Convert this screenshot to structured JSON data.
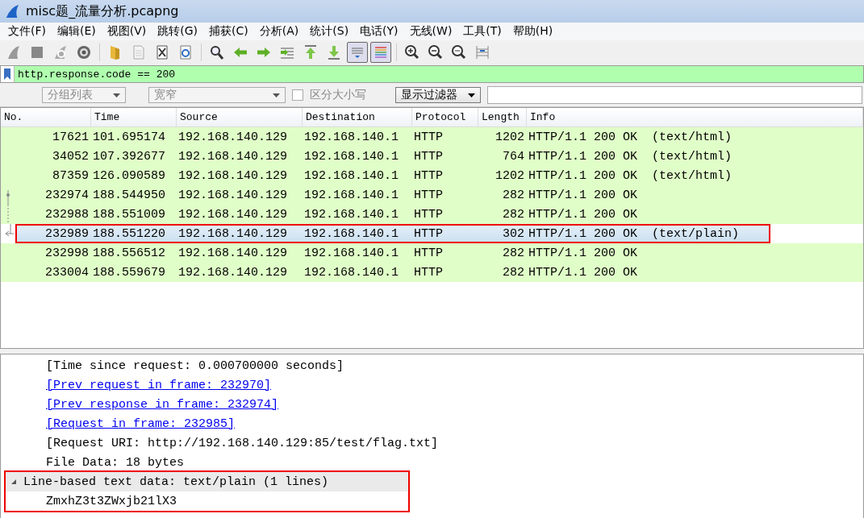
{
  "window": {
    "title": "misc题_流量分析.pcapng"
  },
  "menu": [
    "文件(F)",
    "编辑(E)",
    "视图(V)",
    "跳转(G)",
    "捕获(C)",
    "分析(A)",
    "统计(S)",
    "电话(Y)",
    "无线(W)",
    "工具(T)",
    "帮助(H)"
  ],
  "toolbar": [
    {
      "kind": "fin",
      "pressed": false
    },
    {
      "kind": "stop",
      "pressed": false
    },
    {
      "kind": "restart",
      "pressed": false
    },
    {
      "kind": "gear",
      "pressed": false
    },
    {
      "kind": "sep"
    },
    {
      "kind": "folder",
      "pressed": false
    },
    {
      "kind": "file",
      "pressed": false
    },
    {
      "kind": "closefile",
      "pressed": false
    },
    {
      "kind": "reload",
      "pressed": false
    },
    {
      "kind": "sep"
    },
    {
      "kind": "search",
      "pressed": false
    },
    {
      "kind": "back",
      "pressed": false
    },
    {
      "kind": "forward",
      "pressed": false
    },
    {
      "kind": "goto",
      "pressed": false
    },
    {
      "kind": "first",
      "pressed": false
    },
    {
      "kind": "last",
      "pressed": false
    },
    {
      "kind": "autoscroll",
      "pressed": true
    },
    {
      "kind": "colorize",
      "pressed": true
    },
    {
      "kind": "sep"
    },
    {
      "kind": "zoomin",
      "pressed": false
    },
    {
      "kind": "zoomout",
      "pressed": false
    },
    {
      "kind": "zoomreset",
      "pressed": false
    },
    {
      "kind": "resize",
      "pressed": false
    }
  ],
  "filter": {
    "value": "http.response.code == 200"
  },
  "search_bar": {
    "scope": {
      "value": "分组列表",
      "disabled": true
    },
    "charset": {
      "value": "宽窄",
      "disabled": true
    },
    "case_sensitive": {
      "label": "区分大小写",
      "checked": false,
      "disabled": true
    },
    "type": {
      "value": "显示过滤器"
    }
  },
  "table": {
    "columns": [
      "No.",
      "Time",
      "Source",
      "Destination",
      "Protocol",
      "Length",
      "Info"
    ],
    "rows": [
      {
        "cells": [
          "17621",
          "101.695174",
          "192.168.140.129",
          "192.168.140.1",
          "HTTP",
          "1202",
          "HTTP/1.1 200 OK  (text/html)"
        ],
        "selected": false,
        "highlighted": false,
        "kind": "plain"
      },
      {
        "cells": [
          "34052",
          "107.392677",
          "192.168.140.129",
          "192.168.140.1",
          "HTTP",
          "764",
          "HTTP/1.1 200 OK  (text/html)"
        ],
        "selected": false,
        "highlighted": false,
        "kind": "plain"
      },
      {
        "cells": [
          "87359",
          "126.090589",
          "192.168.140.129",
          "192.168.140.1",
          "HTTP",
          "1202",
          "HTTP/1.1 200 OK  (text/html)"
        ],
        "selected": false,
        "highlighted": false,
        "kind": "plain"
      },
      {
        "cells": [
          "232974",
          "188.544950",
          "192.168.140.129",
          "192.168.140.1",
          "HTTP",
          "282",
          "HTTP/1.1 200 OK"
        ],
        "selected": false,
        "highlighted": false,
        "kind": "dot"
      },
      {
        "cells": [
          "232988",
          "188.551009",
          "192.168.140.129",
          "192.168.140.1",
          "HTTP",
          "282",
          "HTTP/1.1 200 OK"
        ],
        "selected": false,
        "highlighted": false,
        "kind": "line"
      },
      {
        "cells": [
          "232989",
          "188.551220",
          "192.168.140.129",
          "192.168.140.1",
          "HTTP",
          "302",
          "HTTP/1.1 200 OK  (text/plain)"
        ],
        "selected": true,
        "highlighted": true,
        "kind": "arrow"
      },
      {
        "cells": [
          "232998",
          "188.556512",
          "192.168.140.129",
          "192.168.140.1",
          "HTTP",
          "282",
          "HTTP/1.1 200 OK"
        ],
        "selected": false,
        "highlighted": false,
        "kind": "plain"
      },
      {
        "cells": [
          "233004",
          "188.559679",
          "192.168.140.129",
          "192.168.140.1",
          "HTTP",
          "282",
          "HTTP/1.1 200 OK"
        ],
        "selected": false,
        "highlighted": false,
        "kind": "plain"
      }
    ]
  },
  "details": [
    {
      "kind": "field",
      "text": "[Time since request: 0.000700000 seconds]"
    },
    {
      "kind": "link",
      "text": "[Prev request in frame: 232970]"
    },
    {
      "kind": "link",
      "text": "[Prev response in frame: 232974]"
    },
    {
      "kind": "link",
      "text": "[Request in frame: 232985]"
    },
    {
      "kind": "field",
      "text": "[Request URI: http://192.168.140.129:85/test/flag.txt]"
    },
    {
      "kind": "field",
      "text": "File Data: 18 bytes"
    },
    {
      "kind": "node",
      "text": "Line-based text data: text/plain (1 lines)",
      "expanded": true,
      "highlighted": true,
      "children": [
        {
          "kind": "field",
          "text": "ZmxhZ3t3ZWxjb21lX3"
        }
      ]
    }
  ]
}
